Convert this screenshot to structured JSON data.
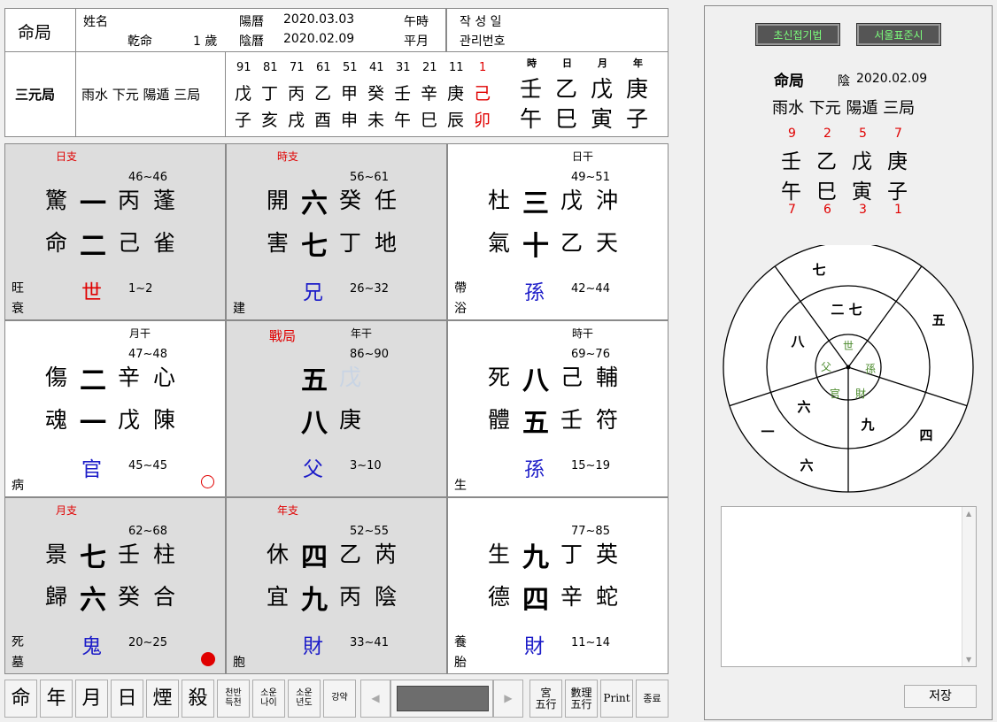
{
  "header": {
    "mingju_label": "命局",
    "name_label": "姓名",
    "gender": "乾命",
    "age": "1 歲",
    "solar_label": "陽曆",
    "solar_date": "2020.03.03",
    "lunar_label": "陰曆",
    "lunar_date": "2020.02.09",
    "hour_label": "午時",
    "month_type": "平月",
    "written_label": "작 성 일",
    "manage_label": "관리번호"
  },
  "sanyuan": {
    "label": "三元局",
    "value": "雨水 下元 陽遁 三局",
    "cycle_numbers": [
      "91",
      "81",
      "71",
      "61",
      "51",
      "41",
      "31",
      "21",
      "11",
      "1"
    ],
    "cycle_stems": [
      "戊",
      "丁",
      "丙",
      "乙",
      "甲",
      "癸",
      "壬",
      "辛",
      "庚",
      "己"
    ],
    "cycle_branches": [
      "子",
      "亥",
      "戌",
      "酉",
      "申",
      "未",
      "午",
      "巳",
      "辰",
      "卯"
    ],
    "pillar_heads": [
      "時",
      "日",
      "月",
      "年"
    ],
    "pillar_stems": [
      "壬",
      "乙",
      "戊",
      "庚"
    ],
    "pillar_branches": [
      "午",
      "巳",
      "寅",
      "子"
    ]
  },
  "grid": [
    {
      "tag": "日支",
      "tag2": "",
      "range": "46~46",
      "r1": [
        "驚",
        "一",
        "丙",
        "蓬"
      ],
      "r2": [
        "命",
        "二",
        "己",
        "雀"
      ],
      "state1": "旺",
      "state2": "衰",
      "rel": "世",
      "rel_color": "red",
      "age": "1~2",
      "mark": ""
    },
    {
      "tag": "時支",
      "tag2": "",
      "range": "56~61",
      "r1": [
        "開",
        "六",
        "癸",
        "任"
      ],
      "r2": [
        "害",
        "七",
        "丁",
        "地"
      ],
      "state1": "",
      "state2": "建",
      "rel": "兄",
      "rel_color": "blue",
      "age": "26~32",
      "mark": ""
    },
    {
      "tag": "日干",
      "tag2": "",
      "range": "49~51",
      "r1": [
        "杜",
        "三",
        "戊",
        "沖"
      ],
      "r2": [
        "氣",
        "十",
        "乙",
        "天"
      ],
      "state1": "帶",
      "state2": "浴",
      "rel": "孫",
      "rel_color": "blue",
      "age": "42~44",
      "mark": ""
    },
    {
      "tag": "月干",
      "tag2": "",
      "range": "47~48",
      "r1": [
        "傷",
        "二",
        "辛",
        "心"
      ],
      "r2": [
        "魂",
        "一",
        "戊",
        "陳"
      ],
      "state1": "",
      "state2": "病",
      "rel": "官",
      "rel_color": "blue",
      "age": "45~45",
      "mark": "circle"
    },
    {
      "tag": "年干",
      "tag2": "戰局",
      "range": "86~90",
      "r1": [
        "",
        "五",
        "戊",
        ""
      ],
      "r2": [
        "",
        "八",
        "庚",
        ""
      ],
      "state1": "",
      "state2": "",
      "rel": "父",
      "rel_color": "blue",
      "age": "3~10",
      "mark": ""
    },
    {
      "tag": "時干",
      "tag2": "",
      "range": "69~76",
      "r1": [
        "死",
        "八",
        "己",
        "輔"
      ],
      "r2": [
        "體",
        "五",
        "壬",
        "符"
      ],
      "state1": "",
      "state2": "生",
      "rel": "孫",
      "rel_color": "blue",
      "age": "15~19",
      "mark": ""
    },
    {
      "tag": "月支",
      "tag2": "",
      "range": "62~68",
      "r1": [
        "景",
        "七",
        "壬",
        "柱"
      ],
      "r2": [
        "歸",
        "六",
        "癸",
        "合"
      ],
      "state1": "死",
      "state2": "墓",
      "rel": "鬼",
      "rel_color": "blue",
      "age": "20~25",
      "mark": "dot"
    },
    {
      "tag": "年支",
      "tag2": "",
      "range": "52~55",
      "r1": [
        "休",
        "四",
        "乙",
        "芮"
      ],
      "r2": [
        "宜",
        "九",
        "丙",
        "陰"
      ],
      "state1": "",
      "state2": "胞",
      "rel": "財",
      "rel_color": "blue",
      "age": "33~41",
      "mark": ""
    },
    {
      "tag": "",
      "tag2": "",
      "range": "77~85",
      "r1": [
        "生",
        "九",
        "丁",
        "英"
      ],
      "r2": [
        "德",
        "四",
        "辛",
        "蛇"
      ],
      "state1": "養",
      "state2": "胎",
      "rel": "財",
      "rel_color": "blue",
      "age": "11~14",
      "mark": ""
    }
  ],
  "toolbar": {
    "buttons": [
      "命",
      "年",
      "月",
      "日",
      "煙",
      "殺"
    ],
    "small_buttons": [
      "천반\n득천",
      "소운\n나이",
      "소운\n년도",
      "강약"
    ],
    "right_buttons": [
      "宮\n五行",
      "數理\n五行",
      "Print",
      "종료"
    ]
  },
  "right_panel": {
    "btn1": "초신접기법",
    "btn2": "서울표준시",
    "title": "命局",
    "lunar_prefix": "陰",
    "lunar_date": "2020.02.09",
    "ju": "雨水 下元 陽遁 三局",
    "top_nums": [
      "9",
      "2",
      "5",
      "7"
    ],
    "stems": [
      "壬",
      "乙",
      "戊",
      "庚"
    ],
    "branches": [
      "午",
      "巳",
      "寅",
      "子"
    ],
    "bottom_nums": [
      "7",
      "6",
      "3",
      "1"
    ],
    "wheel_outer": [
      "七",
      "五",
      "四",
      "六",
      "一"
    ],
    "wheel_mid": [
      "二 七",
      "八",
      "六",
      "九"
    ],
    "wheel_inner": [
      "世",
      "孫",
      "財",
      "官",
      "父"
    ],
    "save_label": "저장"
  }
}
